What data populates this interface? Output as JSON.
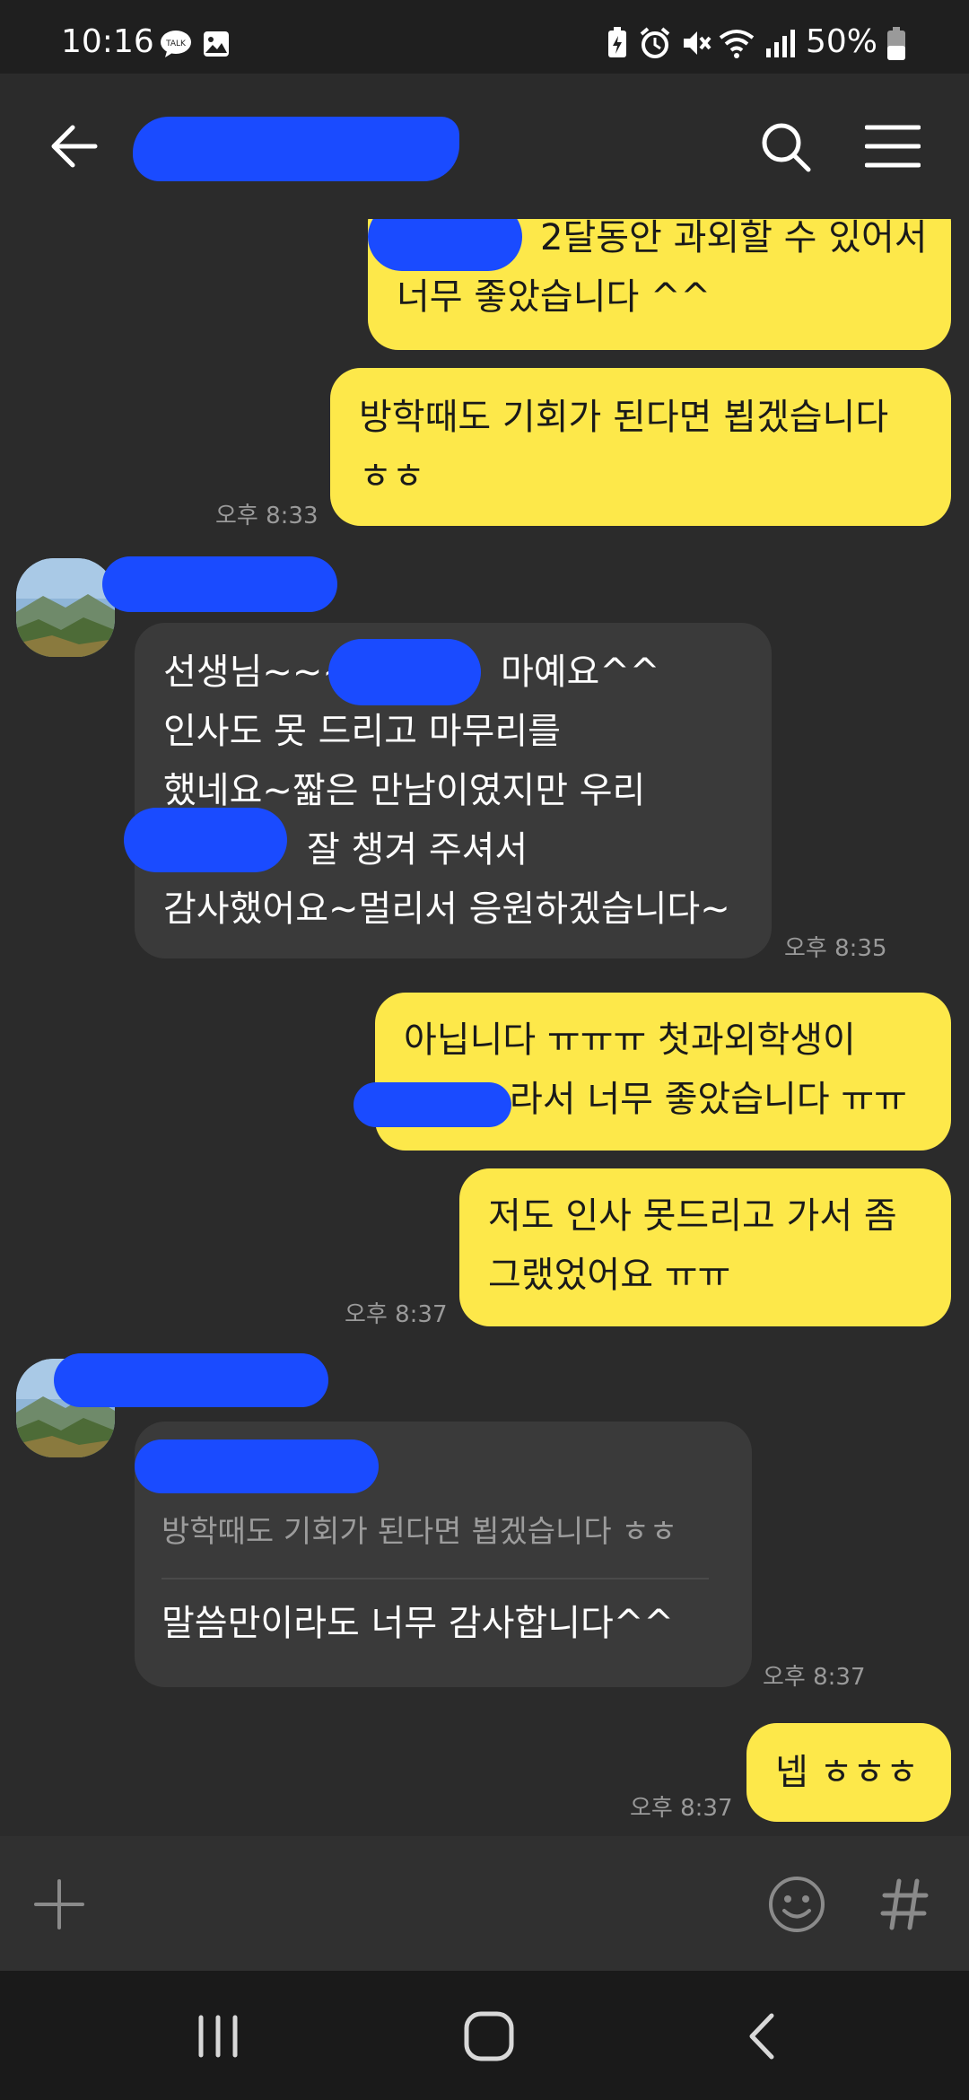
{
  "status_bar": {
    "time": "10:16",
    "battery": "50%",
    "icons": [
      "talk-icon",
      "gallery-icon",
      "battery-saver-icon",
      "alarm-icon",
      "mute-icon",
      "wifi-icon",
      "signal-icon",
      "battery-icon"
    ],
    "talk_badge": "TALK"
  },
  "header": {
    "back_icon": "back-arrow-icon",
    "search_icon": "search-icon",
    "menu_icon": "menu-icon"
  },
  "colors": {
    "my_bubble": "#fde84a",
    "their_bubble": "#3a3a3a",
    "background": "#2b2b2b",
    "redaction": "#1a4bff"
  },
  "messages": [
    {
      "from": "me",
      "lines": [
        "2달동안 과외할 수 있어서",
        "너무 좋았습니다 ^^"
      ]
    },
    {
      "from": "me",
      "lines": [
        "방학때도 기회가 된다면 뵙겠습니다",
        "ㅎㅎ"
      ],
      "time": "오후 8:33"
    },
    {
      "from": "them",
      "lines": [
        "선생님~~~",
        "마예요^^",
        "인사도 못 드리고 마무리를",
        "했네요~짧은 만남이였지만 우리",
        "잘 챙겨 주셔서",
        "감사했어요~멀리서 응원하겠습니다~"
      ],
      "time": "오후 8:35"
    },
    {
      "from": "me",
      "lines": [
        "아닙니다 ㅠㅠㅠ 첫과외학생이",
        "라서 너무 좋았습니다 ㅠㅠ"
      ]
    },
    {
      "from": "me",
      "lines": [
        "저도 인사 못드리고 가서 좀",
        "그랬었어요 ㅠㅠ"
      ],
      "time": "오후 8:37"
    },
    {
      "from": "them",
      "quote": "방학때도 기회가 된다면 뵙겠습니다 ㅎㅎ",
      "lines": [
        "말씀만이라도 너무 감사합니다^^"
      ],
      "time": "오후 8:37"
    },
    {
      "from": "me",
      "lines": [
        "넵 ㅎㅎㅎ"
      ],
      "time": "오후 8:37"
    }
  ],
  "input_bar": {
    "plus_icon": "plus-icon",
    "emoji_icon": "emoji-icon",
    "hash_icon": "hashtag-icon"
  },
  "nav_bar": {
    "recents_icon": "recents-icon",
    "home_icon": "home-icon",
    "back_icon": "nav-back-icon"
  }
}
